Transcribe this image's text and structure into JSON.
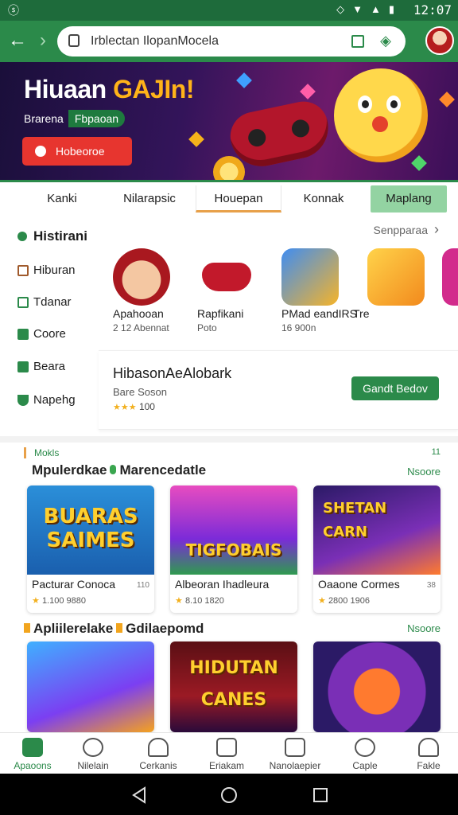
{
  "status_bar": {
    "left": "ⓢ",
    "time": "12:07"
  },
  "browser": {
    "url": "Irblectan IlopanMocela"
  },
  "hero": {
    "title_a": "Hiuaan ",
    "title_b": "GAJIn!",
    "sub_a": "Brarena",
    "sub_b": "Fbpaoan",
    "cta": "Hobeoroe"
  },
  "tabs": [
    {
      "label": "Kanki"
    },
    {
      "label": "Nilarapsic"
    },
    {
      "label": "Houepan"
    },
    {
      "label": "Konnak"
    },
    {
      "label": "Maplang"
    }
  ],
  "sidebar": {
    "title": "Histirani",
    "items": [
      {
        "label": "Hiburan"
      },
      {
        "label": "Tdanar"
      },
      {
        "label": "Coore"
      },
      {
        "label": "Beara"
      },
      {
        "label": "Napehg"
      }
    ]
  },
  "apps": {
    "see_all": "Senpparaa",
    "items": [
      {
        "name": "Apahooan",
        "meta": "2 12 Abennat"
      },
      {
        "name": "Rapfikani",
        "meta": "Poto"
      },
      {
        "name": "PMad eandIRS",
        "meta": "16 900n"
      },
      {
        "name": "Tre",
        "meta": ""
      }
    ]
  },
  "featured": {
    "title": "HibasonAeAlobark",
    "subtitle": "Bare Soson",
    "rating": "100",
    "cta": "Gandt Bedov"
  },
  "section1": {
    "kicker": "Mokls",
    "title_a": "Mpulerdkae",
    "title_b": "Marencedatle",
    "more": "Nsoore",
    "corner": "11",
    "games": [
      {
        "art": "BUARAS SAIMES",
        "name": "Pacturar Conoca",
        "meta": "1.100 9880",
        "side": "110"
      },
      {
        "art": "TIGFOBAIS",
        "name": "Albeoran Ihadleura",
        "meta": "8.10 1820",
        "side": ""
      },
      {
        "art": "SHETAN CARN",
        "name": "Oaaone Cormes",
        "meta": "2800 1906",
        "side": "38"
      }
    ]
  },
  "section2": {
    "title_a": "Apliilerelake",
    "title_b": "Gdilaepomd",
    "more": "Nsoore",
    "games": [
      {
        "art": "",
        "name": "",
        "meta": "",
        "side": ""
      },
      {
        "art": "HIDUTAN CANES",
        "name": "",
        "meta": "",
        "side": ""
      },
      {
        "art": "",
        "name": "",
        "meta": "",
        "side": ""
      }
    ]
  },
  "bottom_nav": [
    {
      "label": "Apaoons"
    },
    {
      "label": "Nilelain"
    },
    {
      "label": "Cerkanis"
    },
    {
      "label": "Eriakam"
    },
    {
      "label": "Nanolaepier"
    },
    {
      "label": "Caple"
    },
    {
      "label": "Fakle"
    }
  ],
  "colors": {
    "brand_green": "#2b8a4a",
    "accent_red": "#e7352f",
    "accent_orange": "#e8a049"
  }
}
